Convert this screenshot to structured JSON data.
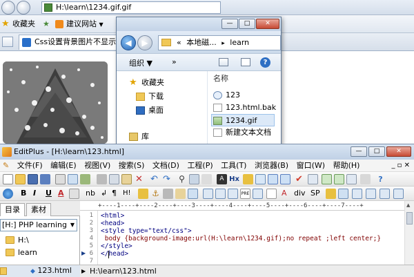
{
  "browser": {
    "address_text": "H:\\learn\\1234.gif.gif",
    "favorites_label": "收藏夹",
    "suggested_sites_label": "建议网站",
    "suggested_dropdown": "▼",
    "tab_title": "Css设置背景图片不显示的..."
  },
  "explorer": {
    "min_symbol": "—",
    "max_symbol": "□",
    "close_symbol": "✕",
    "breadcrumb_prefix": "«",
    "breadcrumb_root": "本地磁...",
    "breadcrumb_sep": "▸",
    "breadcrumb_folder": "learn",
    "organize_label": "组织 ▼",
    "more_label": "»",
    "help_label": "?",
    "favorites_label": "收藏夹",
    "nav_items": [
      "下载",
      "桌面",
      "库"
    ],
    "column_header": "名称",
    "files": [
      "123",
      "123.html.bak",
      "1234.gif",
      "新建文本文档"
    ]
  },
  "editplus": {
    "title": "EditPlus - [H:\\learn\\123.html]",
    "menus": [
      "文件(F)",
      "编辑(E)",
      "视图(V)",
      "搜索(S)",
      "文档(D)",
      "工程(P)",
      "工具(T)",
      "浏览器(B)",
      "窗口(W)",
      "帮助(H)"
    ],
    "menu_controls": "_ ▫ ✕",
    "toolbar2_text": [
      "B",
      "I",
      "U",
      "A",
      "nb",
      "↲",
      "¶",
      "H!",
      "div",
      "SP"
    ],
    "left_tabs": [
      "目录",
      "素材"
    ],
    "drive_select": "[H:] PHP learning",
    "tree": [
      "H:\\",
      "learn"
    ],
    "ruler": "+----1----+----2----+----3----+----4----+----5----+----6----+----7----+",
    "line_numbers": [
      "1",
      "2",
      "3",
      "4",
      "5",
      "6",
      "7"
    ],
    "code_lines": [
      "<html>",
      "<head>",
      "<style type=\"text/css\">",
      " body {background-image:url(H:\\learn\\1234.gif);no repeat ;left center;}",
      "</style>",
      "</head>",
      ""
    ],
    "bottom_file_tab": "123.html",
    "status_path": "H:\\learn\\123.html"
  },
  "colors": {
    "accent": "#3b6ea5",
    "code_tag": "#000080",
    "code_attr": "#800000"
  }
}
